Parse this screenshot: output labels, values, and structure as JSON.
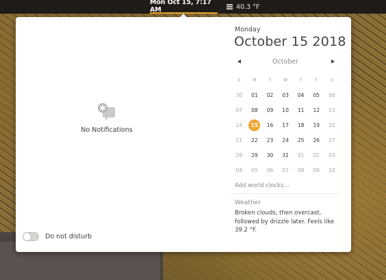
{
  "topbar": {
    "clock": "Mon Oct 15,  7:17 AM",
    "weather_icon": "fog-icon",
    "temperature": "40.3 °F"
  },
  "notifications": {
    "empty_icon": "notifications-icon",
    "empty_label": "No Notifications"
  },
  "dnd": {
    "label": "Do not disturb",
    "enabled": false
  },
  "calendar": {
    "day_name": "Monday",
    "full_date": "October 15 2018",
    "month": "October",
    "weekdays": [
      "S",
      "M",
      "T",
      "W",
      "T",
      "F",
      "S"
    ],
    "weeks": [
      [
        "30",
        "01",
        "02",
        "03",
        "04",
        "05",
        "06"
      ],
      [
        "07",
        "08",
        "09",
        "10",
        "11",
        "12",
        "13"
      ],
      [
        "14",
        "15",
        "16",
        "17",
        "18",
        "19",
        "20"
      ],
      [
        "21",
        "22",
        "23",
        "24",
        "25",
        "26",
        "27"
      ],
      [
        "28",
        "29",
        "30",
        "31",
        "01",
        "02",
        "03"
      ],
      [
        "04",
        "05",
        "06",
        "07",
        "08",
        "09",
        "10"
      ]
    ],
    "today": "15",
    "accent": "#f0a52c"
  },
  "world_clocks": {
    "label": "Add world clocks…"
  },
  "weather": {
    "title": "Weather",
    "summary": "Broken clouds, then overcast, followed by drizzle later. Feels like 39.2 °F."
  }
}
